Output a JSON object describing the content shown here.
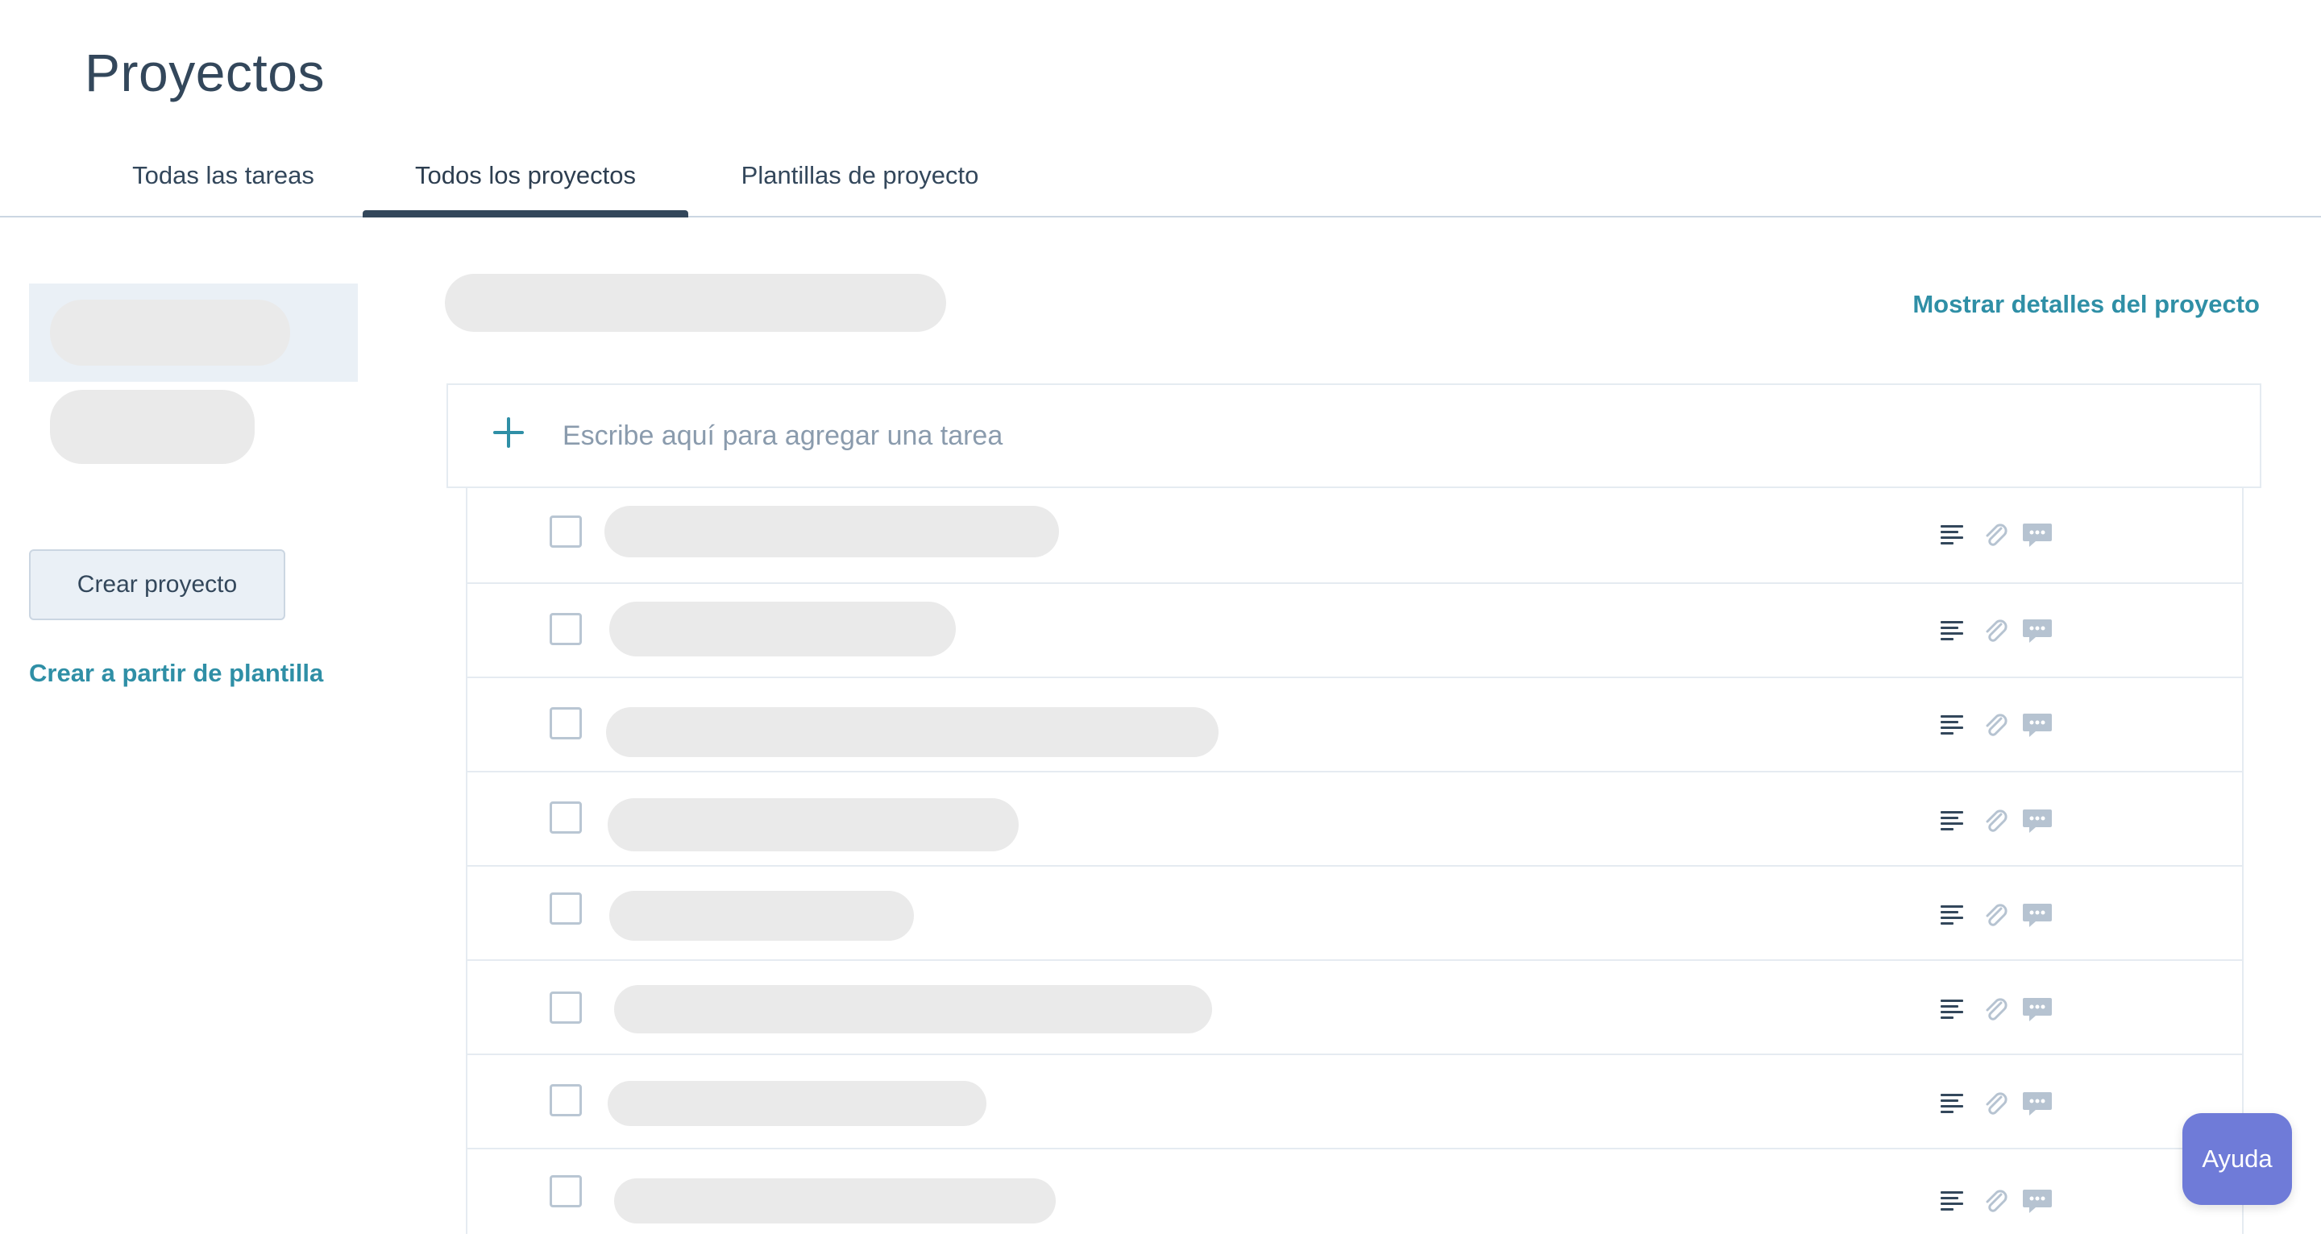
{
  "page": {
    "title": "Proyectos"
  },
  "tabs": [
    {
      "label": "Todas las tareas",
      "active": false
    },
    {
      "label": "Todos los proyectos",
      "active": true
    },
    {
      "label": "Plantillas de proyecto",
      "active": false
    }
  ],
  "sidebar": {
    "create_button": "Crear proyecto",
    "template_link": "Crear a partir de plantilla"
  },
  "main": {
    "details_link": "Mostrar detalles del proyecto",
    "add_task_placeholder": "Escribe aquí para agregar una tarea"
  },
  "task_icons": [
    "description-icon",
    "paperclip-icon",
    "comment-icon"
  ],
  "help": {
    "label": "Ayuda"
  },
  "colors": {
    "accent": "#2f8fa6",
    "text": "#33475b",
    "skeleton": "#eaeaea",
    "help": "#6f7bd8"
  }
}
